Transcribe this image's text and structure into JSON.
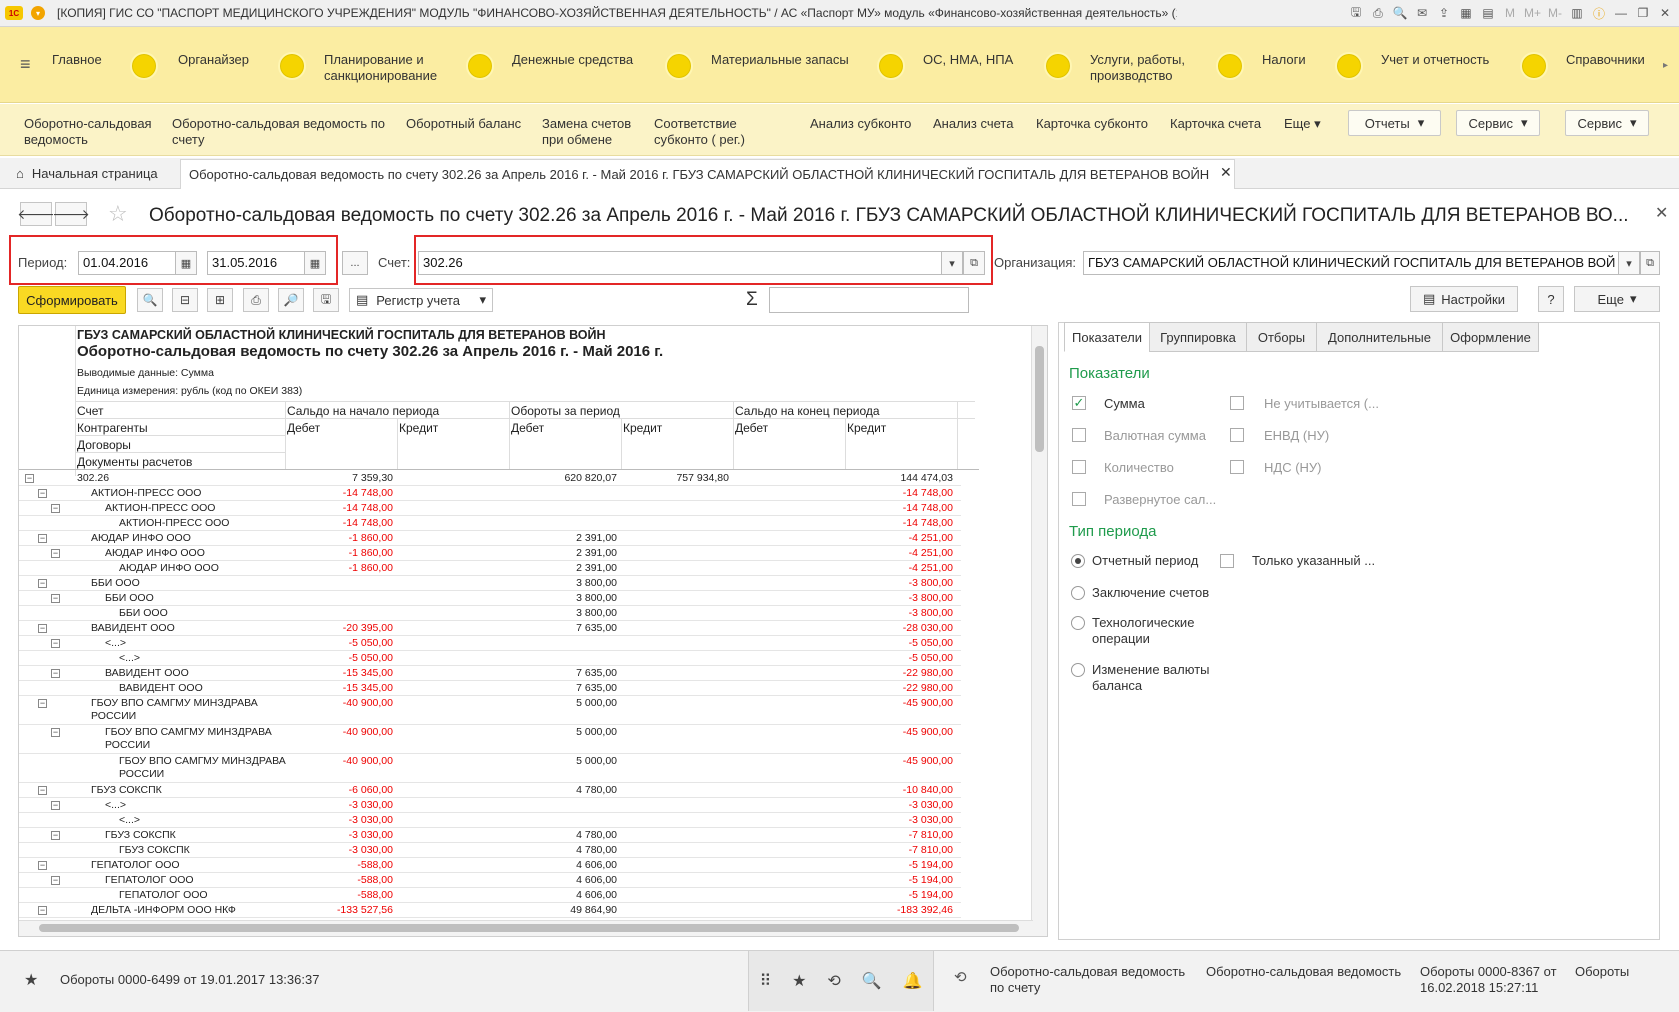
{
  "window": {
    "title": "[КОПИЯ] ГИС СО \"ПАСПОРТ МЕДИЦИНСКОГО УЧРЕЖДЕНИЯ\" МОДУЛЬ \"ФИНАНСОВО-ХОЗЯЙСТВЕННАЯ ДЕЯТЕЛЬНОСТЬ\" / АС «Паспорт МУ» модуль «Финансово-хозяйственная деятельность» (1С:Предприятие)",
    "logo": "1С",
    "tool_icons": [
      "save-icon",
      "print-icon",
      "preview-icon",
      "mail-icon",
      "export-icon",
      "calc-icon",
      "calendar-icon"
    ],
    "mem_labels": [
      "M",
      "M+",
      "M-"
    ]
  },
  "sections": [
    {
      "label": "Главное"
    },
    {
      "label": "Органайзер"
    },
    {
      "label": "Планирование и санкционирование"
    },
    {
      "label": "Денежные средства"
    },
    {
      "label": "Материальные запасы"
    },
    {
      "label": "ОС, НМА, НПА"
    },
    {
      "label": "Услуги, работы, производство"
    },
    {
      "label": "Налоги"
    },
    {
      "label": "Учет и отчетность"
    },
    {
      "label": "Справочники"
    }
  ],
  "commands": [
    {
      "label": "Оборотно-сальдовая ведомость"
    },
    {
      "label": "Оборотно-сальдовая ведомость по счету"
    },
    {
      "label": "Оборотный баланс"
    },
    {
      "label": "Замена счетов при обмене"
    },
    {
      "label": "Соответствие субконто ( рег.)"
    },
    {
      "label": "Анализ субконто"
    },
    {
      "label": "Анализ счета"
    },
    {
      "label": "Карточка субконто"
    },
    {
      "label": "Карточка счета"
    },
    {
      "label": "Еще"
    }
  ],
  "command_buttons": [
    {
      "label": "Отчеты"
    },
    {
      "label": "Сервис"
    },
    {
      "label": "Сервис"
    }
  ],
  "tabs": {
    "home": "Начальная страница",
    "active": "Оборотно-сальдовая ведомость по счету 302.26 за Апрель 2016 г. - Май 2016 г. ГБУЗ САМАРСКИЙ ОБЛАСТНОЙ КЛИНИЧЕСКИЙ ГОСПИТАЛЬ ДЛЯ ВЕТЕРАНОВ ВОЙН"
  },
  "form": {
    "title": "Оборотно-сальдовая ведомость по счету 302.26 за Апрель 2016 г. - Май 2016 г. ГБУЗ САМАРСКИЙ ОБЛАСТНОЙ КЛИНИЧЕСКИЙ ГОСПИТАЛЬ ДЛЯ ВЕТЕРАНОВ ВО...",
    "period_label": "Период:",
    "date_from": "01.04.2016",
    "date_to": "31.05.2016",
    "dots": "...",
    "account_label": "Счет:",
    "account": "302.26",
    "org_label": "Организация:",
    "org": "ГБУЗ САМАРСКИЙ ОБЛАСТНОЙ КЛИНИЧЕСКИЙ ГОСПИТАЛЬ ДЛЯ ВЕТЕРАНОВ ВОЙ",
    "generate": "Сформировать",
    "register": "Регистр учета",
    "sigma": "Σ",
    "settings_btn": "Настройки",
    "help": "?",
    "more": "Еще"
  },
  "report": {
    "org": "ГБУЗ САМАРСКИЙ ОБЛАСТНОЙ КЛИНИЧЕСКИЙ ГОСПИТАЛЬ ДЛЯ ВЕТЕРАНОВ ВОЙН",
    "title": "Оборотно-сальдовая ведомость по счету 302.26 за Апрель 2016 г. - Май 2016 г.",
    "output_data": "Выводимые данные:  Сумма",
    "unit": "Единица измерения: рубль (код по ОКЕИ 383)",
    "col_headers": [
      "Счет",
      "Контрагенты",
      "Договоры",
      "Документы расчетов"
    ],
    "group_headers": [
      "Сальдо на начало периода",
      "Обороты за период",
      "Сальдо на конец периода"
    ],
    "sub_headers": [
      "Дебет",
      "Кредит",
      "Дебет",
      "Кредит",
      "Дебет",
      "Кредит"
    ],
    "rows": [
      {
        "level": 0,
        "name": "302.26",
        "c1": "7 359,30",
        "c2": "620 820,07",
        "c3": "757 934,80",
        "c4": "144 474,03"
      },
      {
        "level": 1,
        "name": "АКТИОН-ПРЕСС ООО",
        "c1": "-14 748,00",
        "c4": "-14 748,00"
      },
      {
        "level": 2,
        "name": "АКТИОН-ПРЕСС ООО",
        "c1": "-14 748,00",
        "c4": "-14 748,00"
      },
      {
        "level": 3,
        "name": "АКТИОН-ПРЕСС ООО",
        "c1": "-14 748,00",
        "c4": "-14 748,00"
      },
      {
        "level": 1,
        "name": "АЮДАР ИНФО ООО",
        "c1": "-1 860,00",
        "c2": "2 391,00",
        "c4": "-4 251,00"
      },
      {
        "level": 2,
        "name": "АЮДАР ИНФО ООО",
        "c1": "-1 860,00",
        "c2": "2 391,00",
        "c4": "-4 251,00"
      },
      {
        "level": 3,
        "name": "АЮДАР ИНФО ООО",
        "c1": "-1 860,00",
        "c2": "2 391,00",
        "c4": "-4 251,00"
      },
      {
        "level": 1,
        "name": "ББИ ООО",
        "c2": "3 800,00",
        "c4": "-3 800,00"
      },
      {
        "level": 2,
        "name": "ББИ ООО",
        "c2": "3 800,00",
        "c4": "-3 800,00"
      },
      {
        "level": 3,
        "name": "ББИ ООО",
        "c2": "3 800,00",
        "c4": "-3 800,00"
      },
      {
        "level": 1,
        "name": "ВАВИДЕНТ ООО",
        "c1": "-20 395,00",
        "c2": "7 635,00",
        "c4": "-28 030,00"
      },
      {
        "level": 2,
        "name": "<...>",
        "c1": "-5 050,00",
        "c4": "-5 050,00"
      },
      {
        "level": 3,
        "name": "<...>",
        "c1": "-5 050,00",
        "c4": "-5 050,00"
      },
      {
        "level": 2,
        "name": "ВАВИДЕНТ ООО",
        "c1": "-15 345,00",
        "c2": "7 635,00",
        "c4": "-22 980,00"
      },
      {
        "level": 3,
        "name": "ВАВИДЕНТ ООО",
        "c1": "-15 345,00",
        "c2": "7 635,00",
        "c4": "-22 980,00"
      },
      {
        "level": 1,
        "name": "ГБОУ ВПО САМГМУ МИНЗДРАВА РОССИИ",
        "c1": "-40 900,00",
        "c2": "5 000,00",
        "c4": "-45 900,00",
        "tall": true
      },
      {
        "level": 2,
        "name": "ГБОУ ВПО САМГМУ МИНЗДРАВА РОССИИ",
        "c1": "-40 900,00",
        "c2": "5 000,00",
        "c4": "-45 900,00",
        "tall": true
      },
      {
        "level": 3,
        "name": "ГБОУ ВПО САМГМУ МИНЗДРАВА РОССИИ",
        "c1": "-40 900,00",
        "c2": "5 000,00",
        "c4": "-45 900,00",
        "tall": true
      },
      {
        "level": 1,
        "name": "ГБУЗ СОКСПК",
        "c1": "-6 060,00",
        "c2": "4 780,00",
        "c4": "-10 840,00"
      },
      {
        "level": 2,
        "name": "<...>",
        "c1": "-3 030,00",
        "c4": "-3 030,00"
      },
      {
        "level": 3,
        "name": "<...>",
        "c1": "-3 030,00",
        "c4": "-3 030,00"
      },
      {
        "level": 2,
        "name": "ГБУЗ СОКСПК",
        "c1": "-3 030,00",
        "c2": "4 780,00",
        "c4": "-7 810,00"
      },
      {
        "level": 3,
        "name": "ГБУЗ СОКСПК",
        "c1": "-3 030,00",
        "c2": "4 780,00",
        "c4": "-7 810,00"
      },
      {
        "level": 1,
        "name": "ГЕПАТОЛОГ ООО",
        "c1": "-588,00",
        "c2": "4 606,00",
        "c4": "-5 194,00"
      },
      {
        "level": 2,
        "name": "ГЕПАТОЛОГ ООО",
        "c1": "-588,00",
        "c2": "4 606,00",
        "c4": "-5 194,00"
      },
      {
        "level": 3,
        "name": "ГЕПАТОЛОГ ООО",
        "c1": "-588,00",
        "c2": "4 606,00",
        "c4": "-5 194,00"
      },
      {
        "level": 1,
        "name": "ДЕЛЬТА -ИНФОРМ ООО НКФ",
        "c1": "-133 527,56",
        "c2": "49 864,90",
        "c4": "-183 392,46"
      }
    ]
  },
  "settings": {
    "tabs": [
      "Показатели",
      "Группировка",
      "Отборы",
      "Дополнительные",
      "Оформление"
    ],
    "group_indicators": "Показатели",
    "checks": [
      {
        "label": "Сумма",
        "checked": true
      },
      {
        "label": "Валютная сумма",
        "checked": false
      },
      {
        "label": "Количество",
        "checked": false
      },
      {
        "label": "Развернутое сал...",
        "checked": false
      },
      {
        "label": "Не учитывается (...",
        "checked": false
      },
      {
        "label": "ЕНВД (НУ)",
        "checked": false
      },
      {
        "label": "НДС (НУ)",
        "checked": false
      }
    ],
    "group_period": "Тип периода",
    "radios": [
      {
        "label": "Отчетный период",
        "checked": true
      },
      {
        "label": "Заключение счетов",
        "checked": false
      },
      {
        "label": "Технологические операции",
        "checked": false
      },
      {
        "label": "Изменение валюты баланса",
        "checked": false
      }
    ],
    "only_specified": "Только указанный ..."
  },
  "statusbar": {
    "left": "Обороты 0000-6499 от 19.01.2017 13:36:37",
    "history": [
      "Оборотно-сальдовая ведомость по счету",
      "Оборотно-сальдовая ведомость",
      "Обороты 0000-8367 от 16.02.2018 15:27:11",
      "Обороты"
    ]
  }
}
